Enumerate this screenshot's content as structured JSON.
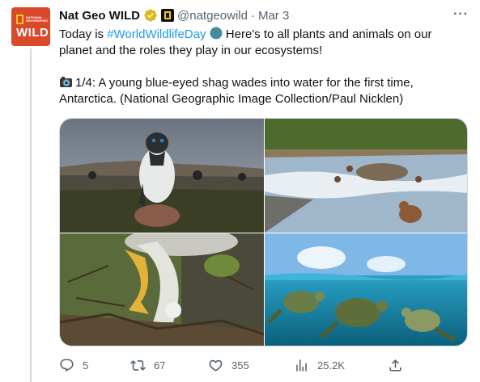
{
  "tweet": {
    "author": {
      "name": "Nat Geo WILD",
      "handle": "@natgeowild",
      "separator": "·",
      "date": "Mar 3",
      "avatar_text": "WILD",
      "avatar_small_text": "NATIONAL GEOGRAPHIC"
    },
    "text": {
      "line1_prefix": "Today is ",
      "hashtag": "#WorldWildlifeDay",
      "line1_suffix": " Here's to all plants and animals on our planet and the roles they play in our ecosystems!",
      "line2": "1/4: A young blue-eyed shag wades into water for the first time, Antarctica. (National Geographic Image Collection/Paul Nicklen)"
    },
    "media": [
      {
        "name": "shag-photo",
        "icon": "photo"
      },
      {
        "name": "bear-river-photo",
        "icon": "photo"
      },
      {
        "name": "eagle-nest-photo",
        "icon": "photo"
      },
      {
        "name": "sea-turtles-photo",
        "icon": "photo"
      }
    ],
    "actions": {
      "replies": "5",
      "retweets": "67",
      "likes": "355",
      "views": "25.2K"
    },
    "colors": {
      "link": "#1d9bf0",
      "secondary_text": "#536471",
      "avatar_bg": "#d9492c",
      "verified": "#f5c518"
    }
  }
}
